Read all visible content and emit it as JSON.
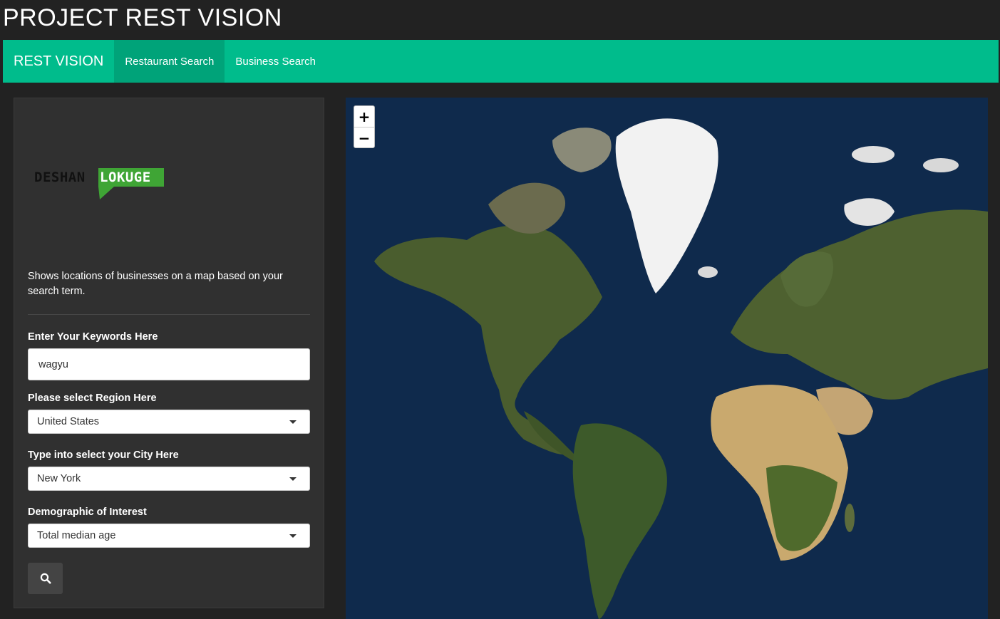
{
  "app_title": "PROJECT REST VISION",
  "navbar": {
    "brand": "REST VISION",
    "tabs": [
      {
        "label": "Restaurant Search",
        "active": true
      },
      {
        "label": "Business Search",
        "active": false
      }
    ],
    "color": "#00bc8c",
    "active_color": "#00a379"
  },
  "sidebar": {
    "logo": {
      "text_left": "DESHAN",
      "text_right": "LOKUGE",
      "accent": "#3fa535"
    },
    "description": "Shows locations of businesses on a map based on your search term.",
    "keywords": {
      "label": "Enter Your Keywords Here",
      "value": "wagyu"
    },
    "region": {
      "label": "Please select Region Here",
      "value": "United States"
    },
    "city": {
      "label": "Type into select your City Here",
      "value": "New York"
    },
    "demographic": {
      "label": "Demographic of Interest",
      "value": "Total median age"
    },
    "search_button_icon": "search-icon"
  },
  "map": {
    "zoom_in": "+",
    "zoom_out": "−",
    "ocean_color": "#0f2a4c",
    "land_color": "#4a5d2e",
    "ice_color": "#f2f2f2",
    "desert_color": "#c4a574"
  }
}
